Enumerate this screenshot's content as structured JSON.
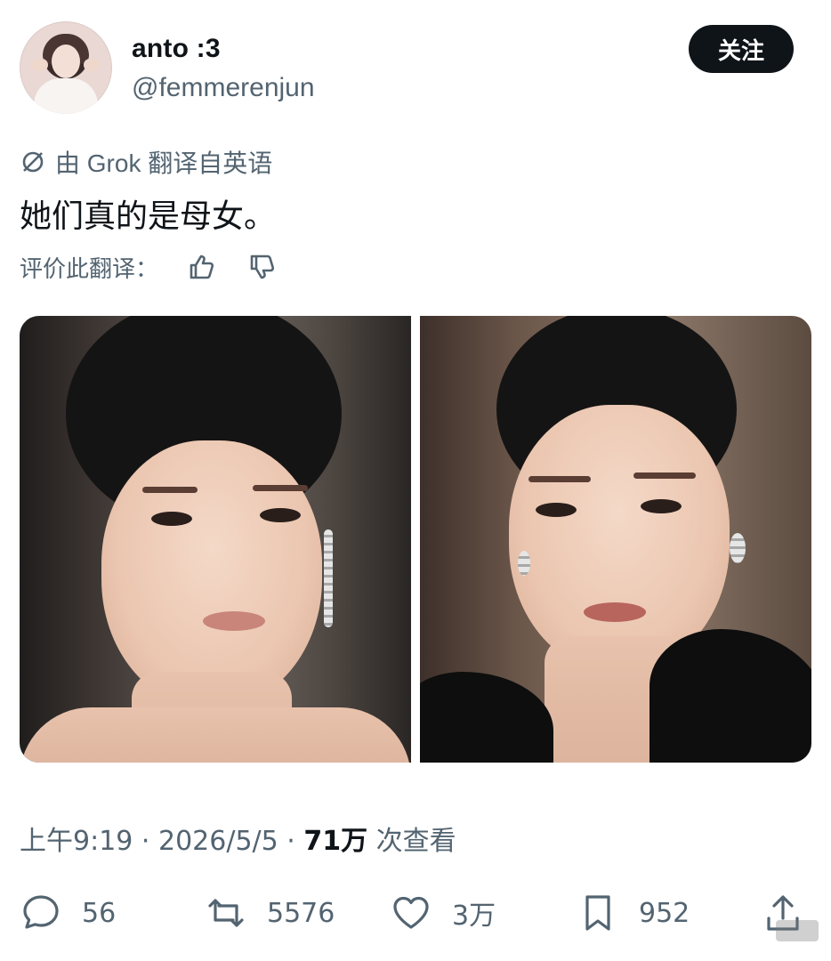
{
  "author": {
    "display_name": "anto :3",
    "handle": "@femmerenjun"
  },
  "follow_button_label": "关注",
  "translation": {
    "label": "由 Grok 翻译自英语",
    "text": "她们真的是母女。",
    "rate_label": "评价此翻译："
  },
  "meta": {
    "time": "上午9:19",
    "sep1": " · ",
    "date": "2026/5/5",
    "sep2": " · ",
    "views_count": "71万",
    "views_label": " 次查看"
  },
  "actions": {
    "reply_count": "56",
    "repost_count": "5576",
    "like_count": "3万",
    "bookmark_count": "952"
  },
  "icons": [
    "grok-icon",
    "thumbs-up-icon",
    "thumbs-down-icon",
    "reply-icon",
    "repost-icon",
    "like-icon",
    "bookmark-icon",
    "share-icon"
  ]
}
